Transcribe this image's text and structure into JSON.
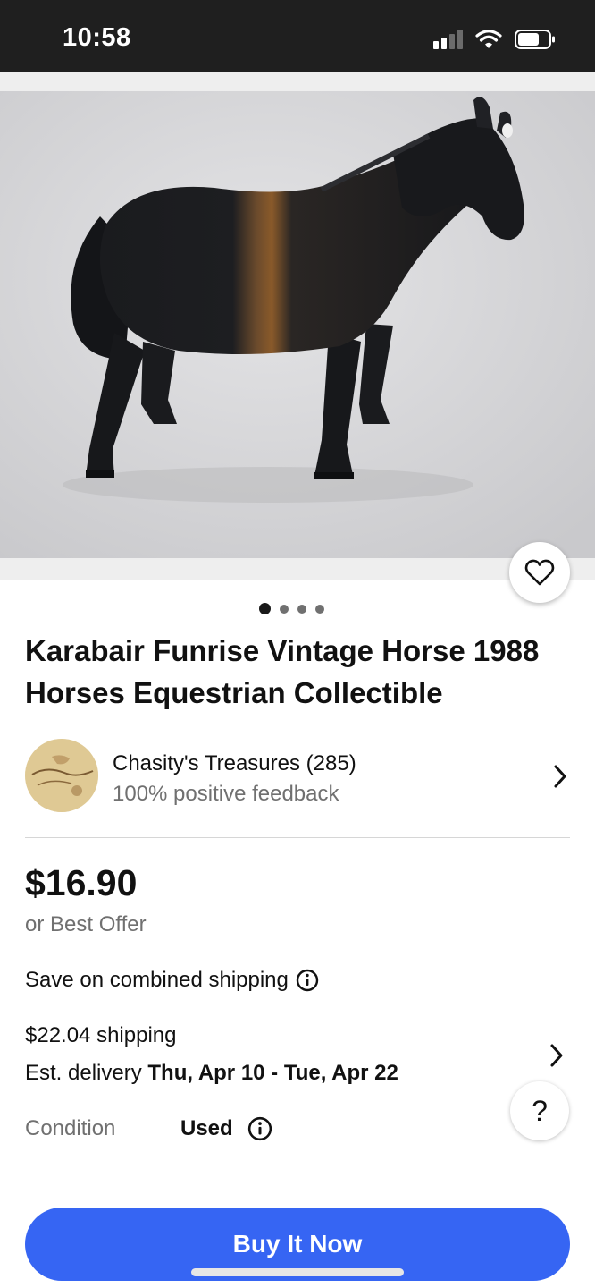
{
  "status_bar": {
    "time": "10:58",
    "icons": [
      "cellular-signal-icon",
      "wifi-icon",
      "battery-icon"
    ]
  },
  "gallery": {
    "image_subject": "black toy horse figurine",
    "total_images": 4,
    "current_image": 1,
    "favorite_icon": "heart-outline-icon"
  },
  "listing": {
    "title": "Karabair Funrise Vintage Horse 1988 Horses Equestrian Collectible"
  },
  "seller": {
    "name": "Chasity's Treasures (285)",
    "feedback": "100% positive feedback",
    "chevron_icon": "chevron-right-icon"
  },
  "pricing": {
    "price": "$16.90",
    "best_offer": "or Best Offer",
    "combined_shipping": "Save on combined shipping",
    "info_icon": "info-icon"
  },
  "shipping": {
    "cost": "$22.04 shipping",
    "delivery_prefix": "Est. delivery ",
    "delivery_dates": "Thu, Apr 10 - Tue, Apr 22"
  },
  "condition": {
    "label": "Condition",
    "value": "Used"
  },
  "help_button": {
    "label": "?"
  },
  "actions": {
    "buy_now": "Buy It Now"
  },
  "colors": {
    "accent": "#3665f3",
    "status_bar_bg": "#1f1f1f",
    "muted_text": "#707070"
  }
}
